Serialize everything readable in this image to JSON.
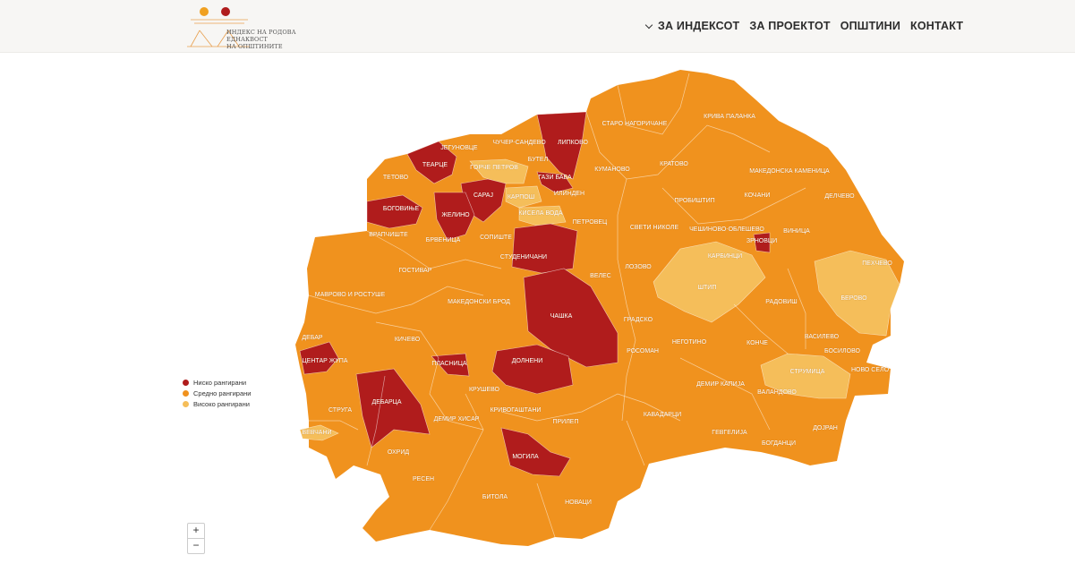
{
  "header": {
    "logo_line1": "ИНДЕКС НА РОДОВА ЕДНАКВОСТ",
    "logo_line2": "НА ОПШТИНИТЕ",
    "nav": [
      {
        "label": "ЗА ИНДЕКСОТ",
        "has_dropdown": true
      },
      {
        "label": "ЗА ПРОЕКТОТ",
        "has_dropdown": false
      },
      {
        "label": "ОПШТИНИ",
        "has_dropdown": false
      },
      {
        "label": "КОНТАКТ",
        "has_dropdown": false
      }
    ]
  },
  "colors": {
    "low": "#b01c1c",
    "medium": "#f0921e",
    "high": "#f5be5a"
  },
  "legend": [
    {
      "key": "low",
      "label": "Ниско рангирани"
    },
    {
      "key": "medium",
      "label": "Средно рангирани"
    },
    {
      "key": "high",
      "label": "Високо рангирани"
    }
  ],
  "zoom": {
    "in": "+",
    "out": "−"
  },
  "municipalities": [
    {
      "name": "СТАРО НАГОРИЧАНЕ",
      "rank": "medium"
    },
    {
      "name": "КРИВА ПАЛАНКА",
      "rank": "medium"
    },
    {
      "name": "ЈЕГУНОВЦЕ",
      "rank": "medium"
    },
    {
      "name": "ЧУЧЕР-САНДЕВО",
      "rank": "medium"
    },
    {
      "name": "ЛИПКОВО",
      "rank": "low"
    },
    {
      "name": "ТЕАРЦЕ",
      "rank": "low"
    },
    {
      "name": "ЃОРЧЕ ПЕТРОВ",
      "rank": "high"
    },
    {
      "name": "БУТЕЛ",
      "rank": "medium"
    },
    {
      "name": "КУМАНОВО",
      "rank": "medium"
    },
    {
      "name": "КРАТОВО",
      "rank": "medium"
    },
    {
      "name": "МАКЕДОНСКА КАМЕНИЦА",
      "rank": "medium"
    },
    {
      "name": "ТЕТОВО",
      "rank": "medium"
    },
    {
      "name": "ГАЗИ БАБА",
      "rank": "low"
    },
    {
      "name": "САРАЈ",
      "rank": "low"
    },
    {
      "name": "КАРПОШ",
      "rank": "high"
    },
    {
      "name": "ИЛИНДЕН",
      "rank": "medium"
    },
    {
      "name": "ПРОБИШТИП",
      "rank": "medium"
    },
    {
      "name": "КОЧАНИ",
      "rank": "medium"
    },
    {
      "name": "ДЕЛЧЕВО",
      "rank": "medium"
    },
    {
      "name": "БОГОВИЊЕ",
      "rank": "low"
    },
    {
      "name": "ЖЕЛИНО",
      "rank": "low"
    },
    {
      "name": "КИСЕЛА ВОДА",
      "rank": "high"
    },
    {
      "name": "ПЕТРОВЕЦ",
      "rank": "medium"
    },
    {
      "name": "СВЕТИ НИКОЛЕ",
      "rank": "medium"
    },
    {
      "name": "ЧЕШИНОВО-ОБЛЕШЕВО",
      "rank": "medium"
    },
    {
      "name": "ЗРНОВЦИ",
      "rank": "low"
    },
    {
      "name": "ВИНИЦА",
      "rank": "medium"
    },
    {
      "name": "ВРАПЧИШТЕ",
      "rank": "medium"
    },
    {
      "name": "БРВЕНИЦА",
      "rank": "medium"
    },
    {
      "name": "СОПИШТЕ",
      "rank": "medium"
    },
    {
      "name": "КАРБИНЦИ",
      "rank": "medium"
    },
    {
      "name": "СТУДЕНИЧАНИ",
      "rank": "low"
    },
    {
      "name": "ПЕХЧЕВО",
      "rank": "medium"
    },
    {
      "name": "ГОСТИВАР",
      "rank": "medium"
    },
    {
      "name": "ВЕЛЕС",
      "rank": "medium"
    },
    {
      "name": "ЛОЗОВО",
      "rank": "medium"
    },
    {
      "name": "ШТИП",
      "rank": "high"
    },
    {
      "name": "МАВРОВО И РОСТУШЕ",
      "rank": "medium"
    },
    {
      "name": "МАКЕДОНСКИ БРОД",
      "rank": "medium"
    },
    {
      "name": "РАДОВИШ",
      "rank": "medium"
    },
    {
      "name": "БЕРОВО",
      "rank": "high"
    },
    {
      "name": "ЧАШКА",
      "rank": "low"
    },
    {
      "name": "ГРАДСКО",
      "rank": "medium"
    },
    {
      "name": "ДЕБАР",
      "rank": "medium"
    },
    {
      "name": "КИЧЕВО",
      "rank": "medium"
    },
    {
      "name": "НЕГОТИНО",
      "rank": "medium"
    },
    {
      "name": "КОНЧЕ",
      "rank": "medium"
    },
    {
      "name": "ВАСИЛЕВО",
      "rank": "medium"
    },
    {
      "name": "БОСИЛОВО",
      "rank": "medium"
    },
    {
      "name": "ЦЕНТАР ЖУПА",
      "rank": "low"
    },
    {
      "name": "ПЛАСНИЦА",
      "rank": "low"
    },
    {
      "name": "ДОЛНЕНИ",
      "rank": "low"
    },
    {
      "name": "РОСОМАН",
      "rank": "medium"
    },
    {
      "name": "СТРУМИЦА",
      "rank": "high"
    },
    {
      "name": "НОВО СЕЛО",
      "rank": "medium"
    },
    {
      "name": "КРУШЕВО",
      "rank": "medium"
    },
    {
      "name": "ДЕМИР КАПИЈА",
      "rank": "medium"
    },
    {
      "name": "ВАЛАНДОВО",
      "rank": "medium"
    },
    {
      "name": "ДЕБАРЦА",
      "rank": "low"
    },
    {
      "name": "СТРУГА",
      "rank": "medium"
    },
    {
      "name": "КРИВОГАШТАНИ",
      "rank": "medium"
    },
    {
      "name": "ДЕМИР ХИСАР",
      "rank": "medium"
    },
    {
      "name": "ПРИЛЕП",
      "rank": "medium"
    },
    {
      "name": "КАВАДАРЦИ",
      "rank": "medium"
    },
    {
      "name": "ДОЈРАН",
      "rank": "medium"
    },
    {
      "name": "ВЕВЧАНИ",
      "rank": "high"
    },
    {
      "name": "ГЕВГЕЛИЈА",
      "rank": "medium"
    },
    {
      "name": "БОГДАНЦИ",
      "rank": "medium"
    },
    {
      "name": "ОХРИД",
      "rank": "medium"
    },
    {
      "name": "МОГИЛА",
      "rank": "low"
    },
    {
      "name": "РЕСЕН",
      "rank": "medium"
    },
    {
      "name": "БИТОЛА",
      "rank": "medium"
    },
    {
      "name": "НОВАЦИ",
      "rank": "medium"
    }
  ]
}
